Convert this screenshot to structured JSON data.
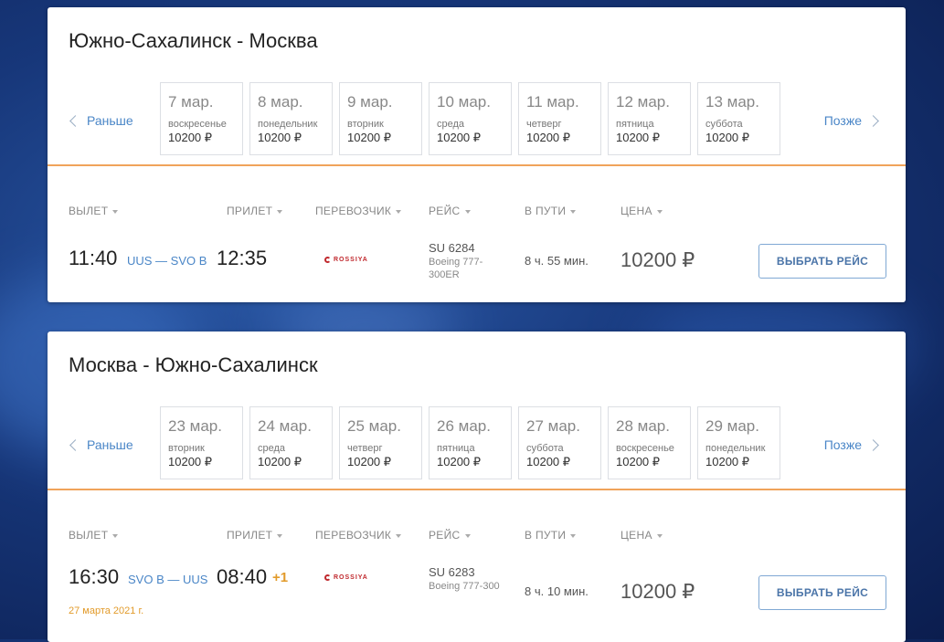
{
  "segments": [
    {
      "route": "Южно-Сахалинск - Москва",
      "prev_label": "Раньше",
      "next_label": "Позже",
      "dates": [
        {
          "date": "7 мар.",
          "weekday": "воскресенье",
          "price": "10200 ₽"
        },
        {
          "date": "8 мар.",
          "weekday": "понедельник",
          "price": "10200 ₽"
        },
        {
          "date": "9 мар.",
          "weekday": "вторник",
          "price": "10200 ₽"
        },
        {
          "date": "10 мар.",
          "weekday": "среда",
          "price": "10200 ₽"
        },
        {
          "date": "11 мар.",
          "weekday": "четверг",
          "price": "10200 ₽"
        },
        {
          "date": "12 мар.",
          "weekday": "пятница",
          "price": "10200 ₽"
        },
        {
          "date": "13 мар.",
          "weekday": "суббота",
          "price": "10200 ₽"
        }
      ],
      "headers": {
        "departure": "ВЫЛЕТ",
        "arrival": "ПРИЛЕТ",
        "carrier": "ПЕРЕВОЗЧИК",
        "flight": "РЕЙС",
        "duration": "В ПУТИ",
        "price": "ЦЕНА"
      },
      "row": {
        "dep_time": "11:40",
        "airports": "UUS — SVO B",
        "arr_time": "12:35",
        "arr_plus": "",
        "carrier": "ROSSIYA",
        "flight_no": "SU 6284",
        "aircraft": "Boeing 777-300ER",
        "duration": "8 ч. 55 мин.",
        "price": "10200 ₽",
        "select_label": "ВЫБРАТЬ РЕЙС",
        "date_note": ""
      }
    },
    {
      "route": "Москва - Южно-Сахалинск",
      "prev_label": "Раньше",
      "next_label": "Позже",
      "dates": [
        {
          "date": "23 мар.",
          "weekday": "вторник",
          "price": "10200 ₽"
        },
        {
          "date": "24 мар.",
          "weekday": "среда",
          "price": "10200 ₽"
        },
        {
          "date": "25 мар.",
          "weekday": "четверг",
          "price": "10200 ₽"
        },
        {
          "date": "26 мар.",
          "weekday": "пятница",
          "price": "10200 ₽"
        },
        {
          "date": "27 мар.",
          "weekday": "суббота",
          "price": "10200 ₽"
        },
        {
          "date": "28 мар.",
          "weekday": "воскресенье",
          "price": "10200 ₽"
        },
        {
          "date": "29 мар.",
          "weekday": "понедельник",
          "price": "10200 ₽"
        }
      ],
      "headers": {
        "departure": "ВЫЛЕТ",
        "arrival": "ПРИЛЕТ",
        "carrier": "ПЕРЕВОЗЧИК",
        "flight": "РЕЙС",
        "duration": "В ПУТИ",
        "price": "ЦЕНА"
      },
      "row": {
        "dep_time": "16:30",
        "airports": "SVO B — UUS",
        "arr_time": "08:40",
        "arr_plus": "+1",
        "carrier": "ROSSIYA",
        "flight_no": "SU 6283",
        "aircraft": "Boeing 777-300",
        "duration": "8 ч. 10 мин.",
        "price": "10200 ₽",
        "select_label": "ВЫБРАТЬ РЕЙС",
        "date_note": "27 марта 2021 г."
      }
    }
  ],
  "colors": {
    "accent": "#4a86c7",
    "divider": "#f0a35a",
    "highlight": "#e29b2b",
    "brand": "#c0282d"
  }
}
